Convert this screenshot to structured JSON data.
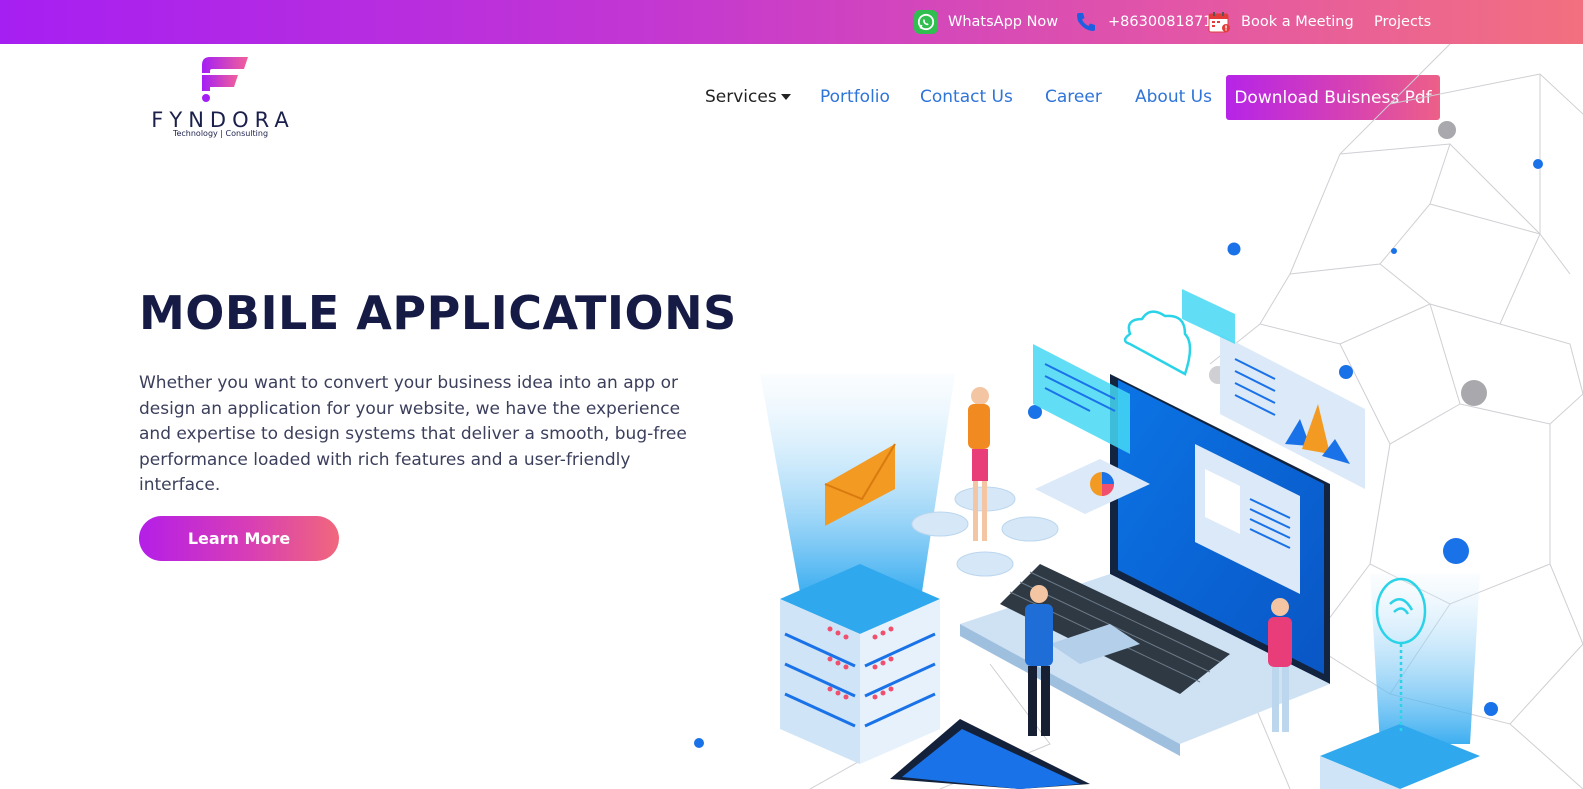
{
  "topbar": {
    "whatsapp_label": "WhatsApp Now",
    "phone_label": "+8630081871",
    "meeting_label": "Book a Meeting",
    "projects_label": "Projects",
    "gradient_start": "#a61ff2",
    "gradient_end": "#f2707f"
  },
  "logo": {
    "word": "FYNDORA",
    "tagline": "Technology | Consulting"
  },
  "nav": {
    "services": "Services",
    "portfolio": "Portfolio",
    "contact": "Contact Us",
    "career": "Career",
    "about": "About Us",
    "download": "Download Buisness Pdf"
  },
  "hero": {
    "title": "MOBILE APPLICATIONS",
    "description": "Whether you want to convert your business idea into an app or design an application for your website, we have the experience and expertise to design systems that deliver a smooth, bug-free performance loaded with rich features and a user-friendly interface.",
    "cta": "Learn More"
  },
  "icons": {
    "whatsapp": "whatsapp-icon",
    "phone": "phone-icon",
    "calendar": "calendar-icon",
    "caret": "caret-down-icon"
  },
  "colors": {
    "accent_purple": "#b624e8",
    "accent_pink": "#ed6088",
    "nav_blue": "#2f74d8",
    "heading_navy": "#151b45"
  }
}
